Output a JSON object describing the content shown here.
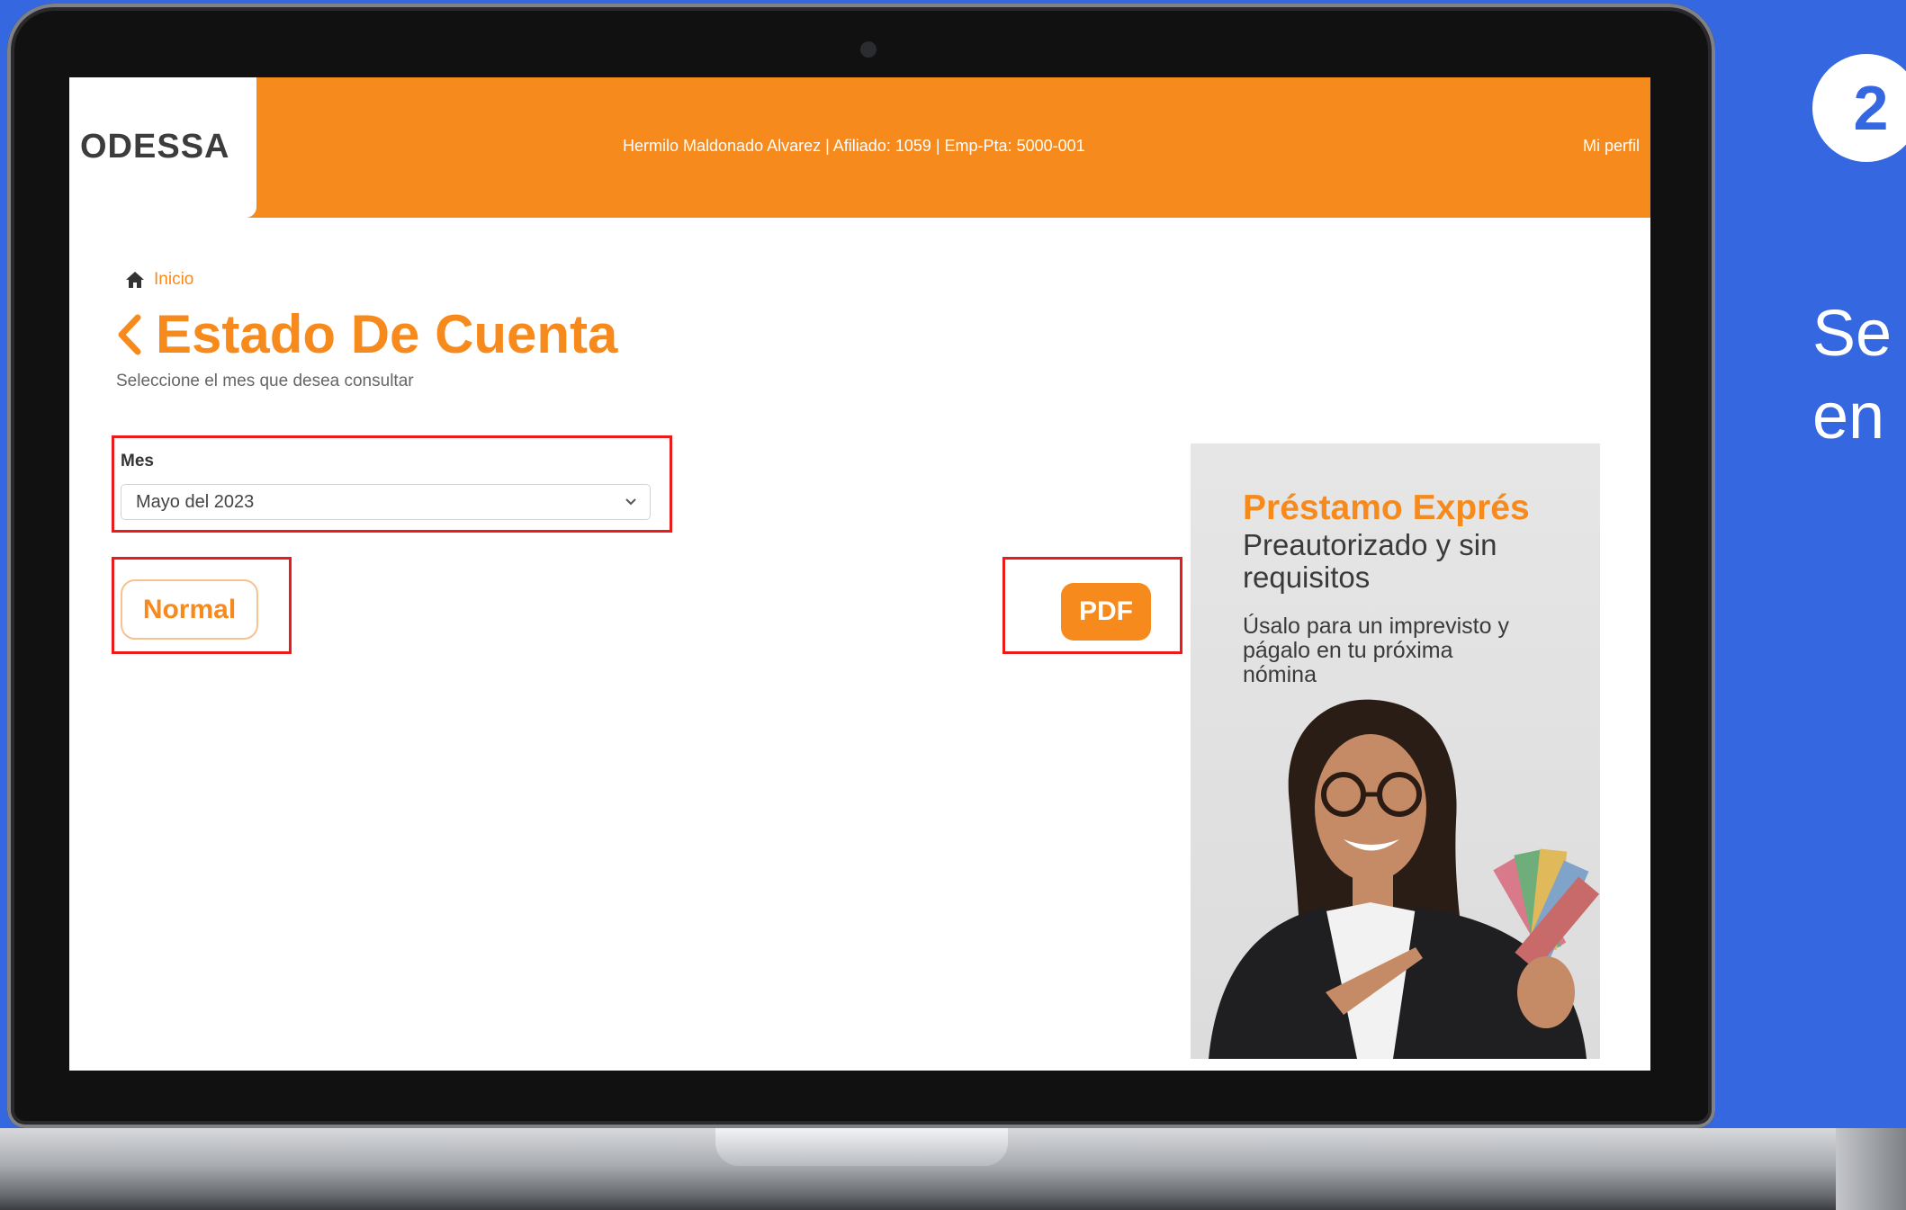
{
  "header": {
    "logo": "ODESSA",
    "user_info": "Hermilo Maldonado Alvarez | Afiliado: 1059 | Emp-Pta: 5000-001",
    "profile_link": "Mi perfil"
  },
  "breadcrumb": {
    "label": "Inicio"
  },
  "page": {
    "title": "Estado De Cuenta",
    "subtitle": "Seleccione el mes que desea consultar"
  },
  "form": {
    "month_label": "Mes",
    "month_value": "Mayo del 2023"
  },
  "buttons": {
    "normal": "Normal",
    "pdf": "PDF"
  },
  "ad": {
    "title": "Préstamo Exprés",
    "subtitle": "Preautorizado y sin requisitos",
    "note": "Úsalo para un imprevisto y págalo en tu próxima nómina"
  },
  "instruction": {
    "step": "2",
    "line1": "Se",
    "line2": "en"
  },
  "colors": {
    "brand_orange": "#f78a1c",
    "background_blue": "#3567e0",
    "highlight_red": "#ea1b1b"
  }
}
